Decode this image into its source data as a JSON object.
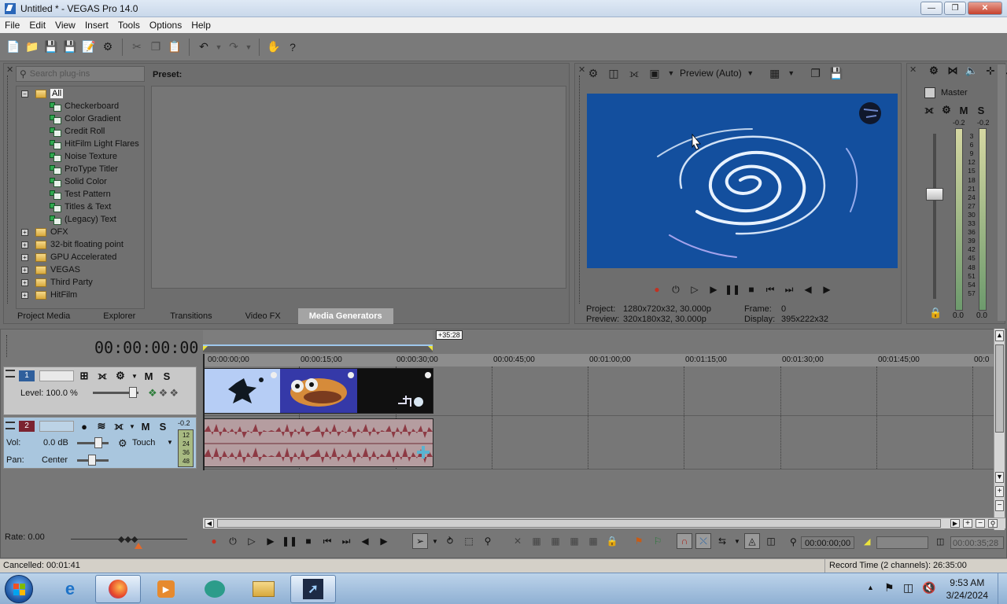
{
  "window": {
    "title": "Untitled * - VEGAS Pro 14.0"
  },
  "menu": [
    "File",
    "Edit",
    "View",
    "Insert",
    "Tools",
    "Options",
    "Help"
  ],
  "plugins": {
    "search_placeholder": "Search plug-ins",
    "preset_label": "Preset:",
    "tree": [
      {
        "label": "All",
        "level": 0,
        "expander": "−",
        "selected": true
      },
      {
        "label": "Checkerboard",
        "level": 1
      },
      {
        "label": "Color Gradient",
        "level": 1
      },
      {
        "label": "Credit Roll",
        "level": 1
      },
      {
        "label": "HitFilm Light Flares",
        "level": 1
      },
      {
        "label": "Noise Texture",
        "level": 1
      },
      {
        "label": "ProType Titler",
        "level": 1
      },
      {
        "label": "Solid Color",
        "level": 1
      },
      {
        "label": "Test Pattern",
        "level": 1
      },
      {
        "label": "Titles & Text",
        "level": 1
      },
      {
        "label": "(Legacy) Text",
        "level": 1
      },
      {
        "label": "OFX",
        "level": 0,
        "expander": "+"
      },
      {
        "label": "32-bit floating point",
        "level": 0,
        "expander": "+"
      },
      {
        "label": "GPU Accelerated",
        "level": 0,
        "expander": "+"
      },
      {
        "label": "VEGAS",
        "level": 0,
        "expander": "+"
      },
      {
        "label": "Third Party",
        "level": 0,
        "expander": "+"
      },
      {
        "label": "HitFilm",
        "level": 0,
        "expander": "+"
      }
    ],
    "tabs": [
      "Project Media",
      "Explorer",
      "Transitions",
      "Video FX",
      "Media Generators"
    ],
    "active_tab": "Media Generators"
  },
  "preview": {
    "mode": "Preview (Auto)",
    "project_label": "Project:",
    "project_value": "1280x720x32, 30.000p",
    "preview_label": "Preview:",
    "preview_value": "320x180x32, 30.000p",
    "frame_label": "Frame:",
    "frame_value": "0",
    "display_label": "Display:",
    "display_value": "395x222x32"
  },
  "master": {
    "label": "Master",
    "m_label": "M",
    "s_label": "S",
    "peak_left": "-0.2",
    "peak_right": "-0.2",
    "scale": [
      "3",
      "6",
      "9",
      "12",
      "15",
      "18",
      "21",
      "24",
      "27",
      "30",
      "33",
      "36",
      "39",
      "42",
      "45",
      "48",
      "51",
      "54",
      "57"
    ],
    "bottom_left": "0.0",
    "bottom_right": "0.0"
  },
  "timeline": {
    "time": "00:00:00:00",
    "region_length": "+35:28",
    "ruler": [
      "00:00:00;00",
      "00:00:15;00",
      "00:00:30;00",
      "00:00:45;00",
      "00:01:00;00",
      "00:01:15;00",
      "00:01:30;00",
      "00:01:45;00",
      "00:0"
    ],
    "video_track": {
      "number": "1",
      "m_label": "M",
      "s_label": "S",
      "level_text": "Level: 100.0 %",
      "level": 1.0
    },
    "audio_track": {
      "number": "2",
      "m_label": "M",
      "s_label": "S",
      "vol_label": "Vol:",
      "vol_value": "0.0 dB",
      "pan_label": "Pan:",
      "pan_value": "Center",
      "automation": "Touch",
      "meter_top": "-0.2",
      "meter_scale": [
        "12",
        "24",
        "36",
        "48"
      ]
    },
    "rate": "Rate: 0.00",
    "cursor_time": "00:00:00;00",
    "end_time": "00:00:35;28"
  },
  "status": {
    "left": "Cancelled: 00:01:41",
    "right": "Record Time (2 channels): 26:35:00"
  },
  "taskbar": {
    "time": "9:53 AM",
    "date": "3/24/2024"
  },
  "colors": {
    "workspace": "#6f6f6f",
    "preview_bg": "#134f9e",
    "waveform": "#8d3a44",
    "audio_header": "#a9c6de",
    "record": "#c23121"
  }
}
